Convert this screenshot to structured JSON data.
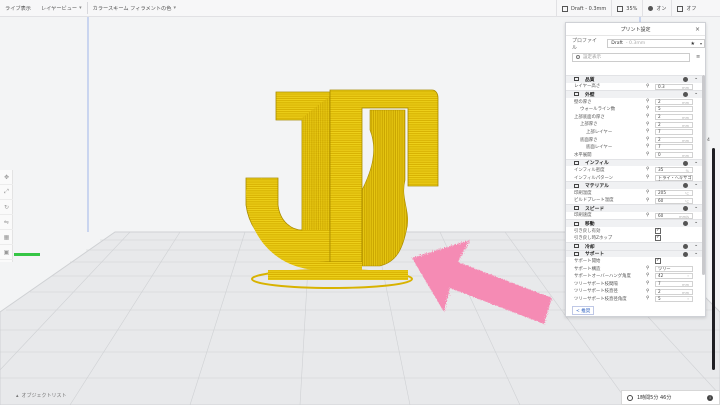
{
  "topbar": {
    "view_items": [
      {
        "label": "ライブ表示"
      },
      {
        "label": "レイヤービュー"
      },
      {
        "label": "カラースキーム  フィラメントの色"
      }
    ],
    "profile_label": "Draft - 0.3mm",
    "infill_percent": "35%",
    "support_label": "オン",
    "adhesion_label": "オフ"
  },
  "settings_panel": {
    "title": "プリント設定",
    "profile_caption": "プロファイル",
    "profile_value": "Draft",
    "profile_sub": "- 0.3mm",
    "search_placeholder": "設定表示",
    "sections": [
      {
        "type": "cat",
        "label": "品質"
      },
      {
        "type": "row",
        "label": "レイヤー高さ",
        "value": "0.3",
        "unit": "mm"
      },
      {
        "type": "cat",
        "label": "外壁"
      },
      {
        "type": "row",
        "label": "壁の厚さ",
        "value": "2",
        "unit": "mm"
      },
      {
        "type": "row",
        "indent": 1,
        "label": "ウォールライン数",
        "value": "5",
        "unit": ""
      },
      {
        "type": "row",
        "label": "上部底面の厚さ",
        "value": "2",
        "unit": "mm"
      },
      {
        "type": "row",
        "indent": 1,
        "label": "上部厚さ",
        "value": "2",
        "unit": "mm"
      },
      {
        "type": "row",
        "indent": 2,
        "label": "上部レイヤー",
        "value": "7",
        "unit": ""
      },
      {
        "type": "row",
        "indent": 1,
        "label": "底面厚さ",
        "value": "2",
        "unit": "mm"
      },
      {
        "type": "row",
        "indent": 2,
        "label": "底面レイヤー",
        "value": "7",
        "unit": ""
      },
      {
        "type": "row",
        "label": "水平展開",
        "value": "0",
        "unit": "mm"
      },
      {
        "type": "cat",
        "label": "インフィル"
      },
      {
        "type": "row",
        "label": "インフィル密度",
        "value": "35",
        "unit": "%"
      },
      {
        "type": "row",
        "label": "インフィルパターン",
        "value": "トライ・ヘキサゴン",
        "unit": ""
      },
      {
        "type": "cat",
        "label": "マテリアル"
      },
      {
        "type": "row",
        "label": "印刷温度",
        "value": "205",
        "unit": "°C"
      },
      {
        "type": "row",
        "label": "ビルドプレート温度",
        "value": "60",
        "unit": "°C"
      },
      {
        "type": "cat",
        "label": "スピード"
      },
      {
        "type": "row",
        "label": "印刷速度",
        "value": "60",
        "unit": "mm/s"
      },
      {
        "type": "cat",
        "label": "移動"
      },
      {
        "type": "row",
        "label": "引き戻し有効",
        "check": true
      },
      {
        "type": "row",
        "label": "引き戻し時Zホップ",
        "check": true
      },
      {
        "type": "cat",
        "label": "冷却"
      },
      {
        "type": "cat",
        "label": "サポート"
      },
      {
        "type": "row",
        "label": "サポート開始",
        "check": true
      },
      {
        "type": "row",
        "label": "サポート構造",
        "value": "ツリー",
        "unit": ""
      },
      {
        "type": "row",
        "label": "サポートオーバーハング角度",
        "value": "42",
        "unit": "°"
      },
      {
        "type": "row",
        "label": "ツリーサポート枝間隔",
        "value": "7",
        "unit": "mm"
      },
      {
        "type": "row",
        "label": "ツリーサポート枝直径",
        "value": "2",
        "unit": "mm"
      },
      {
        "type": "row",
        "label": "ツリーサポート枝直径角度",
        "value": "5",
        "unit": "°"
      }
    ],
    "back_label": "< 推奨"
  },
  "bottom": {
    "object_list_label": "オブジェクトリスト",
    "print_time": "1時間5分 46分"
  },
  "layer_slider": {
    "value": "4"
  },
  "colors": {
    "model": "#d9b400",
    "arrow": "#f58bb4",
    "plate_grid": "#cfd1d4",
    "accent_green": "#35c545"
  }
}
